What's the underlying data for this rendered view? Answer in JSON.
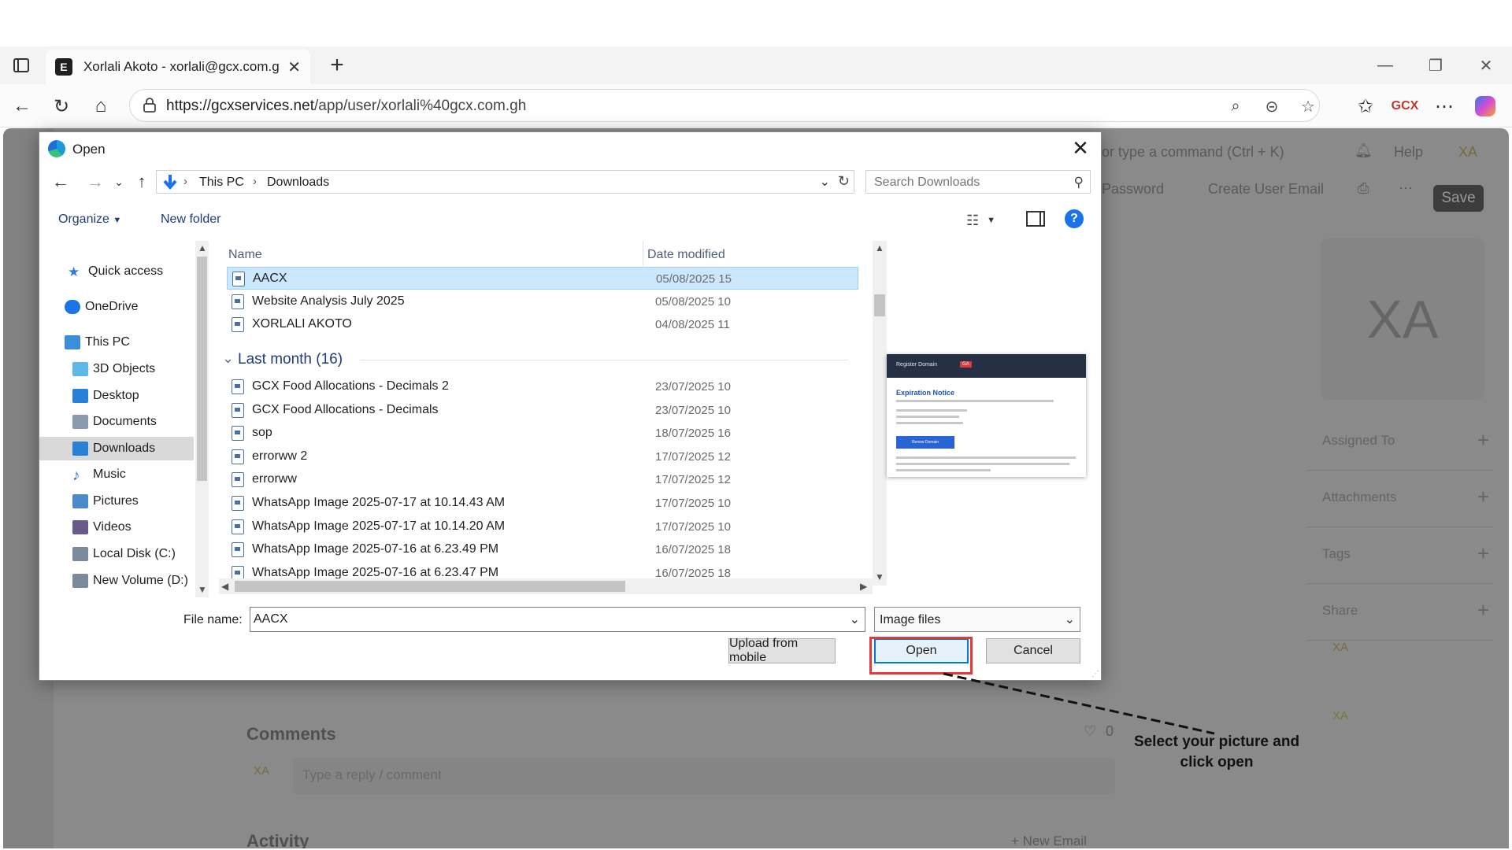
{
  "browser": {
    "tab_title": "Xorlali Akoto - xorlali@gcx.com.gh",
    "tab_favicon_letter": "E",
    "url_host": "https://gcxservices.net",
    "url_path": "/app/user/xorlali%40gcx.com.gh"
  },
  "webpage": {
    "command_placeholder": "or type a command (Ctrl + K)",
    "help_label": "Help",
    "user_initials": "XA",
    "password_label": "Password",
    "create_user_email_label": "Create User Email",
    "save_label": "Save",
    "avatar_initials": "XA",
    "sidebar_rows": [
      {
        "label": "Assigned To"
      },
      {
        "label": "Attachments"
      },
      {
        "label": "Tags"
      },
      {
        "label": "Share"
      }
    ],
    "share_initials": "XA",
    "viewer_initials": "XA",
    "comments_heading": "Comments",
    "like_count": "0",
    "comment_initials": "XA",
    "comment_placeholder": "Type a reply / comment",
    "activity_heading": "Activity",
    "new_email_label": "+ New Email"
  },
  "dialog": {
    "title": "Open",
    "breadcrumb": [
      "This PC",
      "Downloads"
    ],
    "search_placeholder": "Search Downloads",
    "organize_label": "Organize",
    "new_folder_label": "New folder",
    "help_glyph": "?",
    "nav_items": [
      {
        "label": "Quick access",
        "icon": "star-icon"
      },
      {
        "label": "OneDrive",
        "icon": "cloud-icon"
      },
      {
        "label": "This PC",
        "icon": "computer-icon"
      },
      {
        "label": "3D Objects",
        "icon": "cube-icon"
      },
      {
        "label": "Desktop",
        "icon": "desktop-icon"
      },
      {
        "label": "Documents",
        "icon": "documents-icon"
      },
      {
        "label": "Downloads",
        "icon": "download-icon",
        "selected": true
      },
      {
        "label": "Music",
        "icon": "music-icon"
      },
      {
        "label": "Pictures",
        "icon": "pictures-icon"
      },
      {
        "label": "Videos",
        "icon": "videos-icon"
      },
      {
        "label": "Local Disk (C:)",
        "icon": "drive-icon"
      },
      {
        "label": "New Volume (D:)",
        "icon": "drive-icon"
      }
    ],
    "columns": {
      "name": "Name",
      "date": "Date modified"
    },
    "recent_files": [
      {
        "name": "AACX",
        "date": "05/08/2025 15",
        "selected": true
      },
      {
        "name": "Website Analysis July 2025",
        "date": "05/08/2025 10"
      },
      {
        "name": "XORLALI AKOTO",
        "date": "04/08/2025 11"
      }
    ],
    "group_label": "Last month (16)",
    "group_files": [
      {
        "name": "GCX Food Allocations - Decimals 2",
        "date": "23/07/2025 10"
      },
      {
        "name": "GCX Food Allocations - Decimals",
        "date": "23/07/2025 10"
      },
      {
        "name": "sop",
        "date": "18/07/2025 16"
      },
      {
        "name": "errorww 2",
        "date": "17/07/2025 12"
      },
      {
        "name": "errorww",
        "date": "17/07/2025 12"
      },
      {
        "name": "WhatsApp Image 2025-07-17 at 10.14.43 AM",
        "date": "17/07/2025 10"
      },
      {
        "name": "WhatsApp Image 2025-07-17 at 10.14.20 AM",
        "date": "17/07/2025 10"
      },
      {
        "name": "WhatsApp Image 2025-07-16 at 6.23.49 PM",
        "date": "16/07/2025 18"
      },
      {
        "name": "WhatsApp Image 2025-07-16 at 6.23.47 PM",
        "date": "16/07/2025 18"
      }
    ],
    "preview": {
      "header_title": "Register Domain",
      "header_badge": "GA",
      "heading": "Expiration Notice",
      "button_text": "Renew Domain"
    },
    "file_name_label": "File name:",
    "file_name_value": "AACX",
    "file_type_filter": "Image files",
    "upload_mobile_label": "Upload from mobile",
    "open_label": "Open",
    "cancel_label": "Cancel"
  },
  "annotation": {
    "line1": "Select your picture and",
    "line2": "click open",
    "highlight_color": "#e03a3a"
  }
}
